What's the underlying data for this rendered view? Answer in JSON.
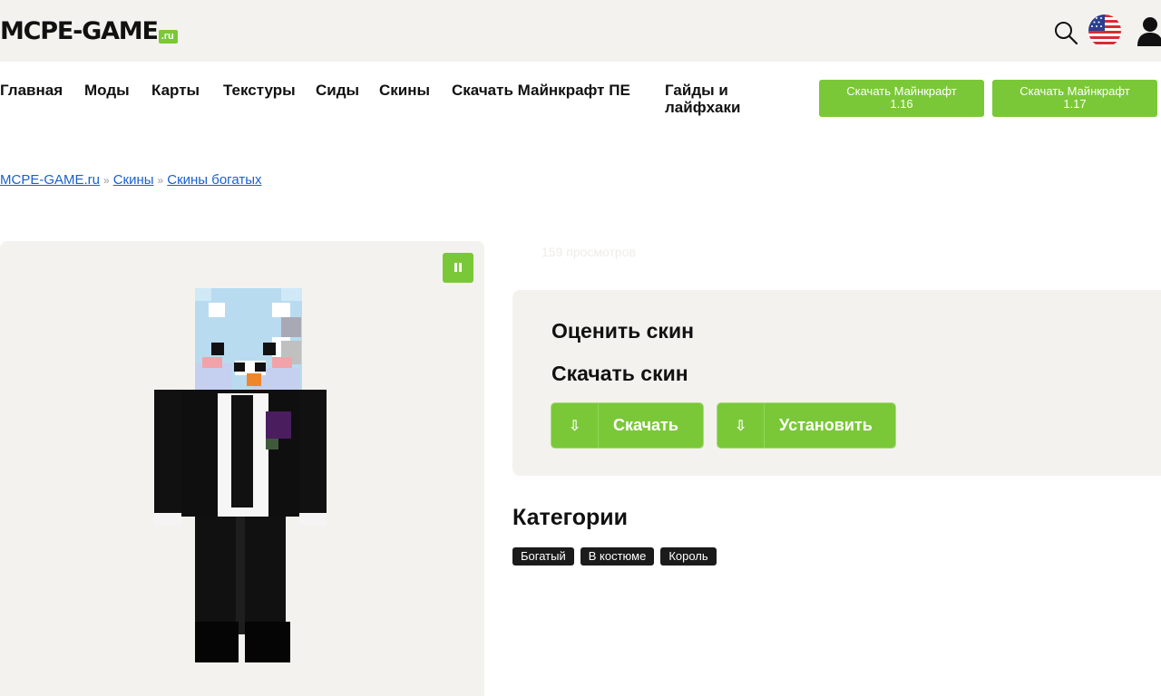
{
  "header": {
    "logo_main": "MCPE-GAME",
    "logo_sub": ".ru"
  },
  "nav": {
    "items": [
      {
        "label": "Главная"
      },
      {
        "label": "Моды"
      },
      {
        "label": "Карты"
      },
      {
        "label": "Текстуры"
      },
      {
        "label": "Сиды"
      },
      {
        "label": "Скины"
      },
      {
        "label": "Скачать Майнкрафт ПЕ"
      },
      {
        "label": "Гайды и лайфхаки"
      }
    ],
    "download_buttons": [
      {
        "line1": "Скачать Майнкрафт",
        "line2": "1.16"
      },
      {
        "line1": "Скачать Майнкрафт",
        "line2": "1.17"
      }
    ]
  },
  "breadcrumb": {
    "items": [
      "MCPE-GAME.ru",
      "Скины",
      "Скины богатых"
    ],
    "separator": "»"
  },
  "skin": {
    "views": "159 просмотров"
  },
  "card": {
    "rate_title": "Оценить скин",
    "download_title": "Скачать скин",
    "download_label": "Скачать",
    "install_label": "Установить"
  },
  "categories": {
    "title": "Категории",
    "tags": [
      "Богатый",
      "В костюме",
      "Король"
    ]
  },
  "colors": {
    "accent": "#7ac837",
    "background_panel": "#f4f2ee",
    "link": "#1a5fd0",
    "tag_bg": "#1b1b1b"
  },
  "icons": {
    "search": "search-icon",
    "flag": "us-flag-icon",
    "user": "user-icon",
    "pause": "pause-icon",
    "download": "download-arrow-icon"
  }
}
